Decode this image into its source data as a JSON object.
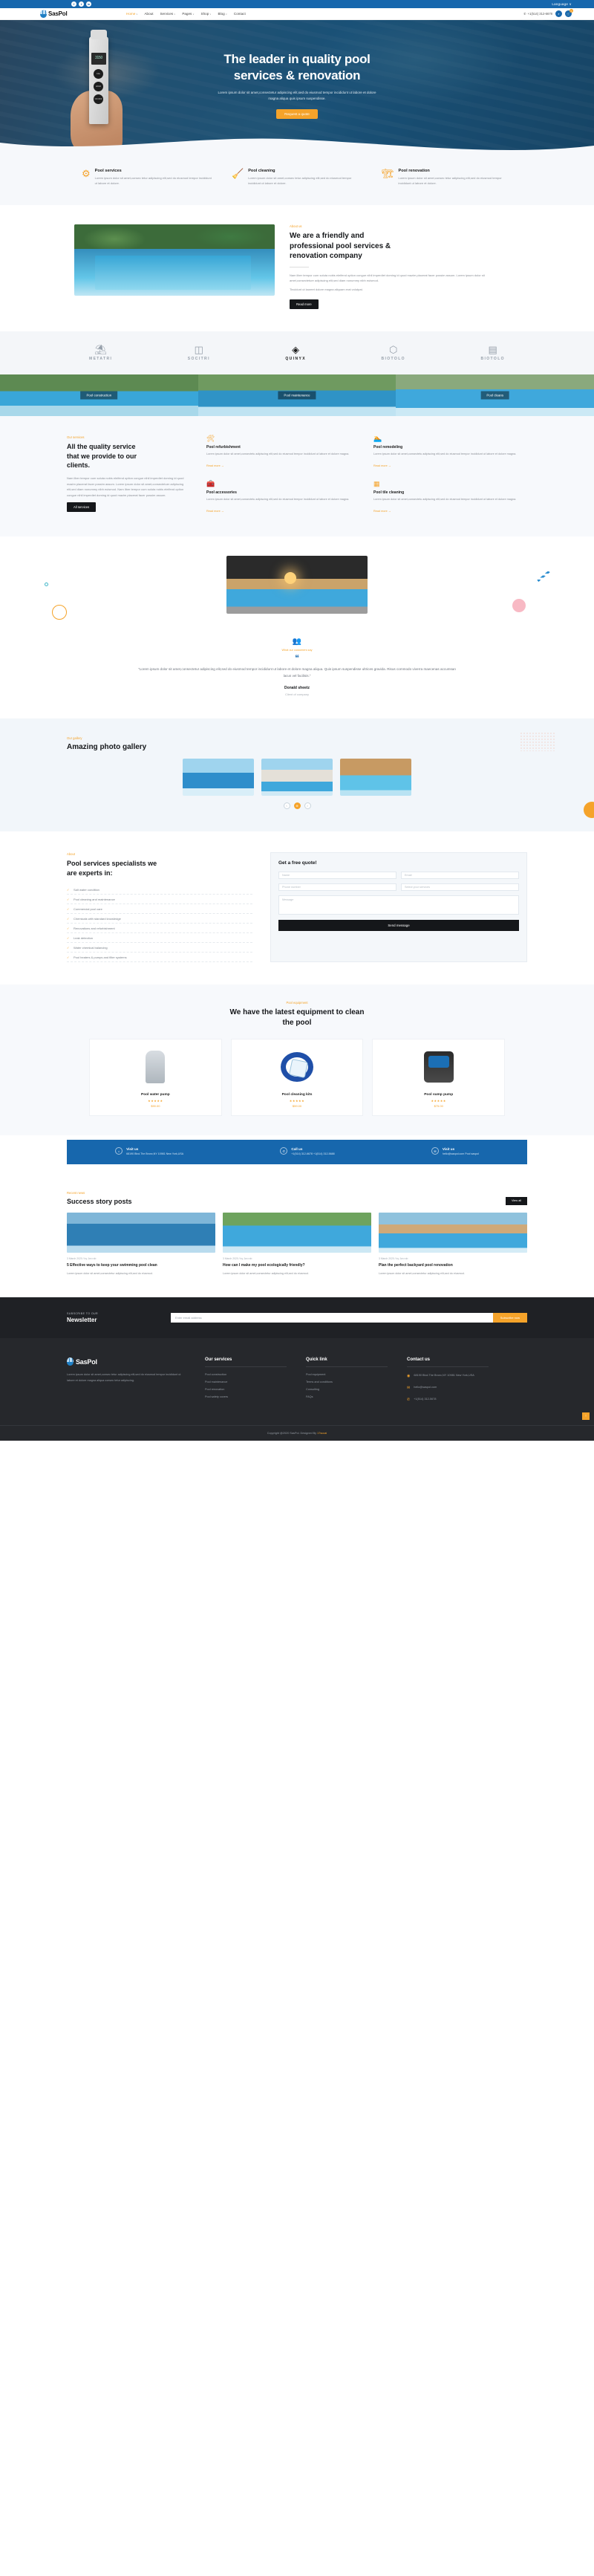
{
  "topbar": {
    "socials": [
      "f",
      "t",
      "in"
    ],
    "language": "Language ∨"
  },
  "header": {
    "brand": "SasPol",
    "nav": [
      {
        "label": "Home",
        "caret": "∨",
        "active": true
      },
      {
        "label": "About",
        "caret": "",
        "active": false
      },
      {
        "label": "Services",
        "caret": "∨",
        "active": false
      },
      {
        "label": "Pages",
        "caret": "∨",
        "active": false
      },
      {
        "label": "Shop",
        "caret": "∨",
        "active": false
      },
      {
        "label": "Blog",
        "caret": "∨",
        "active": false
      },
      {
        "label": "Contact",
        "caret": "",
        "active": false
      }
    ],
    "phone": "+1(514) 312-6678",
    "search_icon": "⌕",
    "cart_icon": "🛒",
    "cart_count": "0"
  },
  "hero": {
    "title_line1": "The leader in quality pool",
    "title_line2": "services & renovation",
    "paragraph_line1": "Lorem ipsum dolor sit amet,consectetur adipiscing elit,sed do eiusmod tempor incididunt ut labore et dolore",
    "paragraph_line2": "magna aliqua quis ipsum suspendisse.",
    "cta": "Request a quote",
    "device_reading": "3150",
    "device_label": "Salt Meter",
    "device_buttons": [
      "CAL",
      "HOLD",
      "ON OFF"
    ]
  },
  "services_strip": [
    {
      "icon": "⚙",
      "title": "Pool services",
      "text": "Lorem ipsum dolor sit amet,consec tetur adipiscing elit,sed do eiusmod tempor incididunt ut labore et dolore."
    },
    {
      "icon": "🧹",
      "title": "Pool cleaning",
      "text": "Lorem ipsum dolor sit amet,consec tetur adipiscing elit,sed do eiusmod tempor incididunt ut labore et dolore."
    },
    {
      "icon": "🏗",
      "title": "Pool renovation",
      "text": "Lorem ipsum dolor sit amet,consec tetur adipiscing elit,sed do eiusmod tempor incididunt ut labore et dolore."
    }
  ],
  "about": {
    "eyebrow": "About us",
    "heading_line1": "We are a friendly and",
    "heading_line2": "professional pool services &",
    "heading_line3": "renovation company",
    "paragraph1": "Nam liber tempor cum soluta nobis eleifend option congue nihil imperdiet doming id quod mazim placerat facer possim assum. Lorem ipsum dolor sit amet,consectetuer adipiscing elit,sed diam nonummy nibh euismod.",
    "paragraph2": "Tincidunt ut laoreet dolore magna aliquam erat volutpat.",
    "button": "Read more"
  },
  "brands": [
    {
      "icon": "⛱",
      "name": "METATRI",
      "active": false
    },
    {
      "icon": "◫",
      "name": "SOCITRI",
      "active": false
    },
    {
      "icon": "◈",
      "name": "QUINYX",
      "active": true
    },
    {
      "icon": "⬡",
      "name": "BIOTOLO",
      "active": false
    },
    {
      "icon": "▤",
      "name": "BIOTOLO",
      "active": false
    }
  ],
  "tiles": [
    {
      "label": "Pool construction"
    },
    {
      "label": "Pool maintenance"
    },
    {
      "label": "Pool cleans"
    }
  ],
  "quality": {
    "eyebrow": "Our services",
    "heading_line1": "All the quality service",
    "heading_line2": "that we provide to our",
    "heading_line3": "clients.",
    "paragraph": "Nam liber tempor cum soluta nobis eleifend option congue nihil imperdiet doming id quod mazim placerat facer possim assum. Lorem ipsum dolor sit amet,consectetuer adipiscing elit,sed diam nonummy nibh euismod. Nam liber tempor cum soluta nobis eleifend option congue nihil imperdiet doming id quod mazim placerat facer possim assum.",
    "button": "All services",
    "items": [
      {
        "icon": "🛠",
        "title": "Pool refurbishment",
        "text": "Lorem ipsum dolor sit amet,consectetu adipiscing elit,sed do eiusmod tempor incididunt ut labore et dolore magna.",
        "more": "Read more  →"
      },
      {
        "icon": "🏊",
        "title": "Pool remodeling",
        "text": "Lorem ipsum dolor sit amet,consectetu adipiscing elit,sed do eiusmod tempor incididunt ut labore et dolore magna.",
        "more": "Read more  →"
      },
      {
        "icon": "🧰",
        "title": "Pool accessories",
        "text": "Lorem ipsum dolor sit amet,consectetu adipiscing elit,sed do eiusmod tempor incididunt ut labore et dolore magna.",
        "more": "Read more  →"
      },
      {
        "icon": "▦",
        "title": "Pool tile cleaning",
        "text": "Lorem ipsum dolor sit amet,consectetu adipiscing elit,sed do eiusmod tempor incididunt ut labore et dolore magna.",
        "more": "Read more  →"
      }
    ]
  },
  "testimonial": {
    "icon": "❝",
    "top_label": "What our customers say",
    "quote": "\"Lorem ipsum dolor sit amet,consectetur adipiscing elit,sed do eiusmod tempor incididunt ut labore et dolore magna aliqua. Quis ipsum suspendisse ultrices gravida. Risus commodo viverra maecenas accumsan lacus vel facilisis.\"",
    "author": "Donald sheetz",
    "role": "Client of company"
  },
  "gallery": {
    "eyebrow": "Our gallery",
    "heading": "Amazing photo gallery",
    "controls": [
      "‹",
      "⊕",
      "›"
    ]
  },
  "experts": {
    "eyebrow": "About",
    "heading_line1": "Pool services specialists we",
    "heading_line2": "are experts in:",
    "list": [
      "Salt water condition",
      "Pool cleaning and maintenance",
      "Commercial pool care",
      "Chemicals with standard knowledge",
      "Renovations and refurbishment",
      "Leak detection",
      "Water chemical balancing",
      "Pool heaters & pumps and filter systems"
    ],
    "form": {
      "title": "Get a free quote!",
      "name_placeholder": "Name",
      "email_placeholder": "Email",
      "phone_placeholder": "Phone number",
      "select_placeholder": "Select your services",
      "message_placeholder": "Message",
      "submit": "Send message"
    }
  },
  "equipment": {
    "eyebrow": "Pool equipment",
    "heading_line1": "We have the latest equipment to clean",
    "heading_line2": "the pool",
    "items": [
      {
        "name": "Pool water pump",
        "stars": "★★★★★",
        "price": "$90.00"
      },
      {
        "name": "Pool cleaning kits",
        "stars": "★★★★★",
        "price": "$59.00"
      },
      {
        "name": "Pool sump pump",
        "stars": "★★★★★",
        "price": "$75.00"
      }
    ]
  },
  "band": [
    {
      "icon": "⌂",
      "title": "Visit us",
      "text": "68190 Blvd.The Bronx,NY 10981 New York,USA"
    },
    {
      "icon": "✆",
      "title": "Call us",
      "text": "+1(514) 312-6678 +1(514) 312-5688"
    },
    {
      "icon": "✉",
      "title": "Visit us",
      "text": "hello@saspol.com Pool saspol"
    }
  ],
  "blog": {
    "eyebrow": "Recent news",
    "heading": "Success story posts",
    "view_all": "View all",
    "posts": [
      {
        "meta": "3 March 2020   /   by Jon rob",
        "title": "5 Effective ways to keep your swimming pool clean",
        "text": "Lorem ipsum dolor sit amet,consectetur adipiscing elit,sed do eiusmod."
      },
      {
        "meta": "3 March 2020   /   by Jon rob",
        "title": "How can I make my pool ecologically friendly?",
        "text": "Lorem ipsum dolor sit amet,consectetur adipiscing elit,sed do eiusmod."
      },
      {
        "meta": "3 March 2020   /   by Jon rob",
        "title": "Plan the perfect backyard pool renovation",
        "text": "Lorem ipsum dolor sit amet,consectetur adipiscing elit,sed do eiusmod."
      }
    ]
  },
  "newsletter": {
    "subtitle": "SUBSCRIBE TO OUR",
    "title": "Newsletter",
    "input_placeholder": "Enter email address",
    "button": "Subscribe now"
  },
  "footer": {
    "brand": "SasPol",
    "about": "Lorem ipsum dolor sit amet,consec tetur adipiscing elit,sed do eiusmod tempor incididunt ut labore et dolore magna aliqua consec tetur adipiscing.",
    "col_services_title": "Our services",
    "col_services": [
      "Pool construction",
      "Pool maintenance",
      "Pool renovation",
      "Pool safety covers"
    ],
    "col_quick_title": "Quick link",
    "col_quick": [
      "Pool equipment",
      "Terms and conditions",
      "Consulting",
      "FAQs"
    ],
    "col_contact_title": "Contact us",
    "contacts": [
      {
        "icon": "◉",
        "text": "68190 Blvd.The Bronx,NY 10981 New York,USA"
      },
      {
        "icon": "✉",
        "text": "hello@saspol.com"
      },
      {
        "icon": "✆",
        "text": "+1(514) 312-5678"
      }
    ],
    "copyright_prefix": "Copyright @2020 SasPol. Designed By ",
    "copyright_link": "17sucai"
  }
}
